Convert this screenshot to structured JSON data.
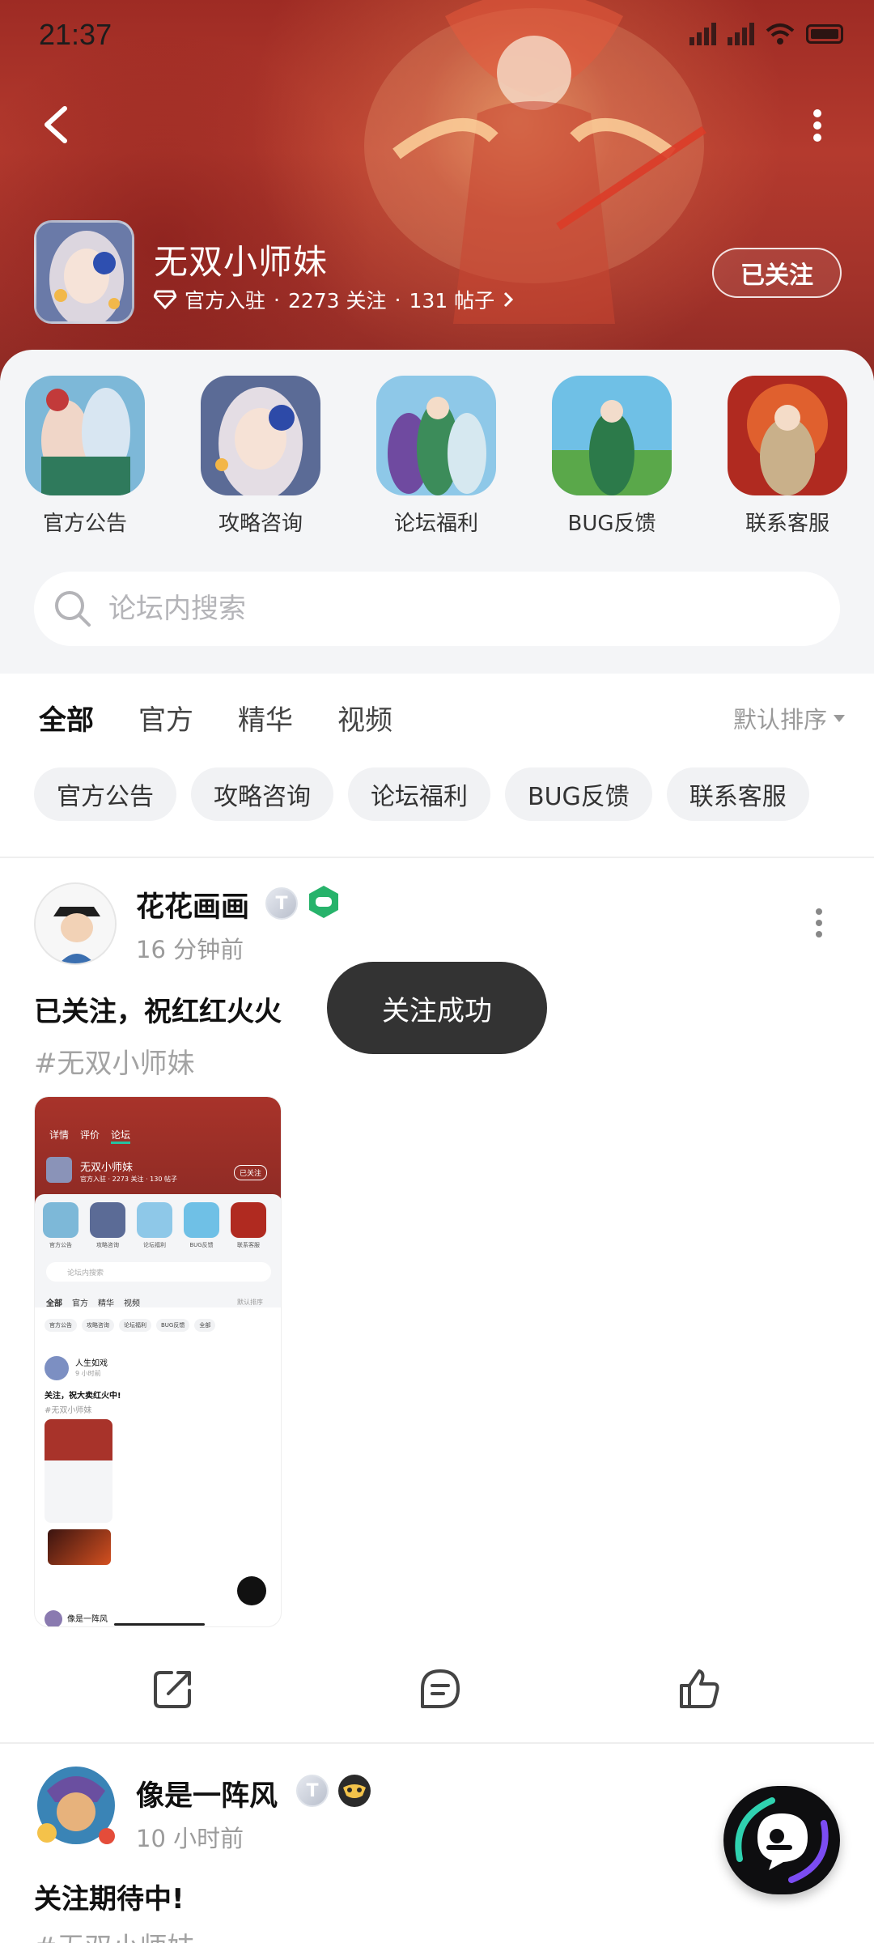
{
  "status_bar": {
    "time": "21:37"
  },
  "header": {
    "forum_name": "无双小师妹",
    "official": "官方入驻",
    "followers": "2273 关注",
    "posts": "131 帖子",
    "separator": "·",
    "follow_button": "已关注"
  },
  "shortcuts": [
    {
      "label": "官方公告"
    },
    {
      "label": "攻略咨询"
    },
    {
      "label": "论坛福利"
    },
    {
      "label": "BUG反馈"
    },
    {
      "label": "联系客服"
    }
  ],
  "search": {
    "placeholder": "论坛内搜索",
    "value": ""
  },
  "tabs": [
    {
      "label": "全部",
      "active": true
    },
    {
      "label": "官方"
    },
    {
      "label": "精华"
    },
    {
      "label": "视频"
    }
  ],
  "sort": {
    "label": "默认排序"
  },
  "chips": [
    "官方公告",
    "攻略咨询",
    "论坛福利",
    "BUG反馈",
    "联系客服"
  ],
  "posts": [
    {
      "user": "花花画画",
      "level": "T",
      "time": "16 分钟前",
      "title": "已关注，祝红红火火",
      "tag": "#无双小师妹",
      "screenshot": {
        "forum_name": "无双小师妹",
        "follow_button": "已关注",
        "tabs": [
          "详情",
          "评价",
          "论坛"
        ],
        "meta": "官方入驻 · 2273 关注 · 130 帖子",
        "shortcuts": [
          "官方公告",
          "攻略咨询",
          "论坛福利",
          "BUG反馈",
          "联系客服"
        ],
        "search": "论坛内搜索",
        "post_tabs": [
          "全部",
          "官方",
          "精华",
          "视频"
        ],
        "sort": "默认排序",
        "chips": [
          "官方公告",
          "攻略咨询",
          "论坛福利",
          "BUG反馈",
          "全部"
        ],
        "inner_user": "人生如戏",
        "inner_time": "9 小时前",
        "inner_title": "关注，祝大卖红火中!",
        "inner_tag": "#无双小师妹",
        "next_user": "像是一阵风"
      }
    },
    {
      "user": "像是一阵风",
      "level": "T",
      "time": "10 小时前",
      "title": "关注期待中!",
      "tag": "#无双小师妹"
    }
  ],
  "toast": "关注成功",
  "colors": {
    "accent": "#25c2a0",
    "header_red": "#b43a2e"
  }
}
